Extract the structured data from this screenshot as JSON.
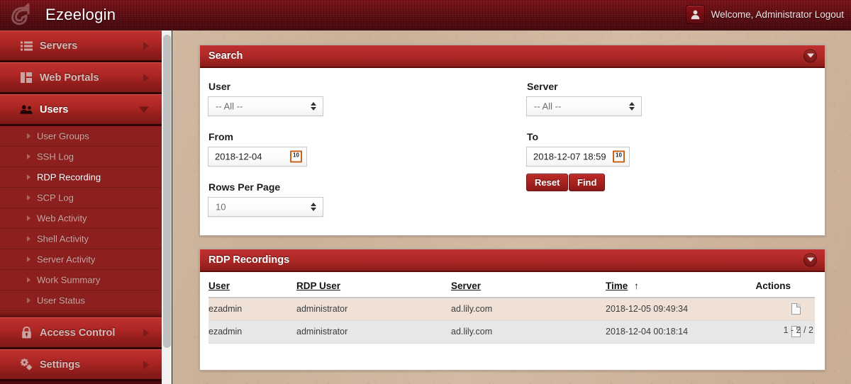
{
  "header": {
    "brand": "Ezeelogin",
    "logo_icon": "ezeelogin-logo-icon",
    "avatar_icon": "user-avatar-icon",
    "welcome": "Welcome, Administrator Logout"
  },
  "sidebar": {
    "items": [
      {
        "label": "Servers",
        "icon": "list-icon",
        "arrow": "right",
        "active": false,
        "expanded": false
      },
      {
        "label": "Web Portals",
        "icon": "grid-icon",
        "arrow": "right",
        "active": false,
        "expanded": false
      },
      {
        "label": "Users",
        "icon": "users-icon",
        "arrow": "down",
        "active": true,
        "expanded": true
      },
      {
        "label": "Access Control",
        "icon": "lock-icon",
        "arrow": "right",
        "active": false,
        "expanded": false
      },
      {
        "label": "Settings",
        "icon": "gears-icon",
        "arrow": "right",
        "active": false,
        "expanded": false
      }
    ],
    "users_submenu": [
      {
        "label": "User Groups",
        "current": false
      },
      {
        "label": "SSH Log",
        "current": false
      },
      {
        "label": "RDP Recording",
        "current": true
      },
      {
        "label": "SCP Log",
        "current": false
      },
      {
        "label": "Web Activity",
        "current": false
      },
      {
        "label": "Shell Activity",
        "current": false
      },
      {
        "label": "Server Activity",
        "current": false
      },
      {
        "label": "Work Summary",
        "current": false
      },
      {
        "label": "User Status",
        "current": false
      }
    ]
  },
  "search_panel": {
    "title": "Search",
    "collapse_icon": "chevron-down-icon",
    "user": {
      "label": "User",
      "value": "-- All --"
    },
    "server": {
      "label": "Server",
      "value": "-- All --"
    },
    "from": {
      "label": "From",
      "value": "2018-12-04",
      "calendar_icon": "calendar-icon",
      "calendar_day": "10"
    },
    "to": {
      "label": "To",
      "value": "2018-12-07 18:59",
      "calendar_icon": "calendar-icon",
      "calendar_day": "10"
    },
    "rows_per_page": {
      "label": "Rows Per Page",
      "value": "10"
    },
    "reset_button": "Reset",
    "find_button": "Find"
  },
  "recordings_panel": {
    "title": "RDP Recordings",
    "collapse_icon": "chevron-down-icon",
    "columns": {
      "user": "User",
      "rdp_user": "RDP User",
      "server": "Server",
      "time": "Time",
      "time_sort_arrow": "↑",
      "actions": "Actions"
    },
    "rows": [
      {
        "user": "ezadmin",
        "rdp_user": "administrator",
        "server": "ad.lily.com",
        "time": "2018-12-05 09:49:34",
        "action_icon": "document-icon"
      },
      {
        "user": "ezadmin",
        "rdp_user": "administrator",
        "server": "ad.lily.com",
        "time": "2018-12-04 00:18:14",
        "action_icon": "document-icon"
      }
    ],
    "pagination": "1 - 2 / 2"
  },
  "colors": {
    "brand_red": "#a8221f",
    "header_dark_red": "#5e0b10",
    "panel_header_red": "#b02a28",
    "page_background": "#cfb6a0",
    "row_odd": "#f0e1d7",
    "row_even": "#e7e7e7"
  }
}
